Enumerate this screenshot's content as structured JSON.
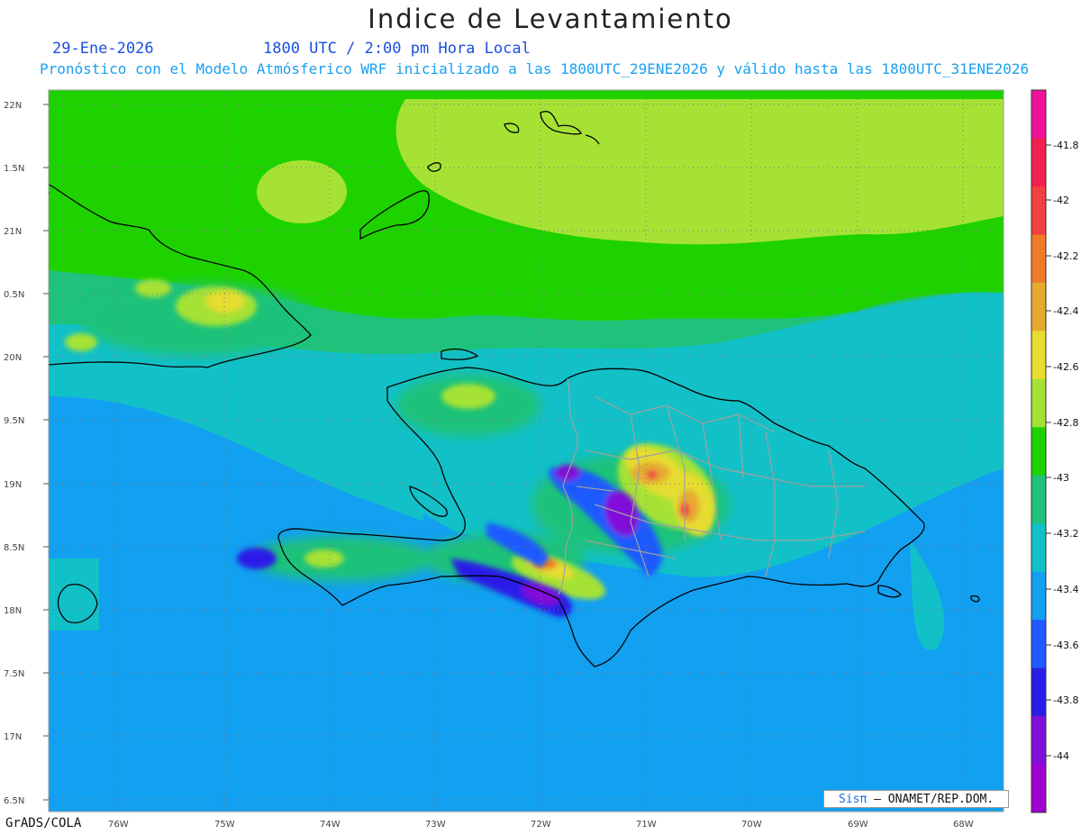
{
  "header": {
    "title": "Indice de Levantamiento",
    "date": "29-Ene-2026",
    "time": "1800 UTC / 2:00 pm Hora Local",
    "forecast": "Pronóstico con el Modelo Atmósferico WRF inicializado a las 1800UTC_29ENE2026 y válido hasta las  1800UTC_31ENE2026"
  },
  "map": {
    "lat_labels": [
      "22N",
      "1.5N",
      "21N",
      "0.5N",
      "20N",
      "9.5N",
      "19N",
      "8.5N",
      "18N",
      "7.5N",
      "17N",
      "6.5N"
    ],
    "lon_labels": [
      "76W",
      "75W",
      "74W",
      "73W",
      "72W",
      "71W",
      "70W",
      "69W",
      "68W"
    ]
  },
  "colorbar": {
    "labels": [
      "-41.8",
      "-42",
      "-42.2",
      "-42.4",
      "-42.6",
      "-42.8",
      "-43",
      "-43.2",
      "-43.4",
      "-43.6",
      "-43.8",
      "-44"
    ],
    "colors": [
      "#f0109a",
      "#f02050",
      "#f04040",
      "#f07a28",
      "#e6aa30",
      "#e6dc32",
      "#a6e234",
      "#1ed200",
      "#1ec27a",
      "#12c0c8",
      "#12a0f0",
      "#1e5aff",
      "#2a1ee6",
      "#8010d8",
      "#a000d0"
    ]
  },
  "footer": {
    "credit": "GrADS/COLA",
    "brand_prefix": "Sis",
    "brand_pi": "π",
    "brand_suffix": "– ONAMET/REP.DOM."
  }
}
